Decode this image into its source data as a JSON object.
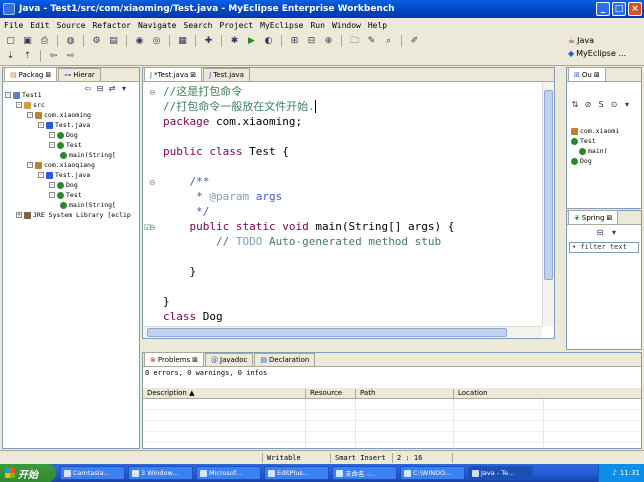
{
  "window": {
    "title": "Java - Test1/src/com/xiaoming/Test.java - MyEclipse Enterprise Workbench"
  },
  "menu": [
    "File",
    "Edit",
    "Source",
    "Refactor",
    "Navigate",
    "Search",
    "Project",
    "MyEclipse",
    "Run",
    "Window",
    "Help"
  ],
  "perspectives": {
    "java": "Java",
    "myeclipse": "MyEclipse ..."
  },
  "left_panel": {
    "tabs": [
      "Packag",
      "Hierar"
    ],
    "tree": [
      {
        "label": "Test1",
        "depth": 0,
        "icon": "project"
      },
      {
        "label": "src",
        "depth": 1,
        "icon": "folder"
      },
      {
        "label": "com.xiaoming",
        "depth": 2,
        "icon": "package"
      },
      {
        "label": "Test.java",
        "depth": 3,
        "icon": "java"
      },
      {
        "label": "Dog",
        "depth": 4,
        "icon": "class"
      },
      {
        "label": "Test",
        "depth": 4,
        "icon": "class"
      },
      {
        "label": "main(String[",
        "depth": 5,
        "icon": "method"
      },
      {
        "label": "com.xiaoqiang",
        "depth": 2,
        "icon": "package"
      },
      {
        "label": "Test.java",
        "depth": 3,
        "icon": "java"
      },
      {
        "label": "Dog",
        "depth": 4,
        "icon": "class"
      },
      {
        "label": "Test",
        "depth": 4,
        "icon": "class"
      },
      {
        "label": "main(String[",
        "depth": 5,
        "icon": "method"
      },
      {
        "label": "JRE System Library [eclip",
        "depth": 1,
        "icon": "library"
      }
    ]
  },
  "editor": {
    "tabs": [
      "*Test.java",
      "Test.java"
    ],
    "lines": [
      [
        {
          "t": "//这是打包命令",
          "c": "cm"
        }
      ],
      [
        {
          "t": "//打包命令一般放在文件开始.",
          "c": "cm"
        }
      ],
      [
        {
          "t": "package",
          "c": "kw"
        },
        {
          "t": " com.xiaoming;",
          "c": ""
        }
      ],
      [],
      [
        {
          "t": "public class",
          "c": "kw"
        },
        {
          "t": " Test {",
          "c": ""
        }
      ],
      [],
      [
        {
          "t": "    /**",
          "c": "jd"
        }
      ],
      [
        {
          "t": "     * ",
          "c": "jd"
        },
        {
          "t": "@param",
          "c": "tg"
        },
        {
          "t": " args",
          "c": "jd"
        }
      ],
      [
        {
          "t": "     */",
          "c": "jd"
        }
      ],
      [
        {
          "t": "    public static void",
          "c": "kw"
        },
        {
          "t": " main(String[] args) {",
          "c": ""
        }
      ],
      [
        {
          "t": "        // ",
          "c": "cm"
        },
        {
          "t": "TODO",
          "c": "tg"
        },
        {
          "t": " Auto-generated method stub",
          "c": "cm"
        }
      ],
      [],
      [
        {
          "t": "    }",
          "c": ""
        }
      ],
      [],
      [
        {
          "t": "}",
          "c": ""
        }
      ],
      [
        {
          "t": "class",
          "c": "kw"
        },
        {
          "t": " Dog",
          "c": ""
        }
      ],
      [
        {
          "t": "{",
          "c": ""
        }
      ]
    ]
  },
  "outline": {
    "tab": "Ou",
    "tree": [
      {
        "label": "com.xiaomi",
        "depth": 0
      },
      {
        "label": "Test",
        "depth": 0
      },
      {
        "label": "main(",
        "depth": 1
      },
      {
        "label": "Dog",
        "depth": 0
      }
    ]
  },
  "spring": {
    "tab": "Spring",
    "filter": "filter text"
  },
  "bottom": {
    "tabs": [
      "Problems",
      "Javadoc",
      "Declaration"
    ],
    "summary": "0 errors, 0 warnings, 0 infos",
    "columns": [
      "Description",
      "Resource",
      "Path",
      "Location"
    ]
  },
  "status": {
    "writable": "Writable",
    "insert": "Smart Insert",
    "position": "2 : 16"
  },
  "taskbar": {
    "start": "开始",
    "tasks": [
      "Camtasia...",
      "3 Window...",
      "Microsof...",
      "EditPlus...",
      "未命名 -...",
      "C:\\WINDO...",
      "Java - Te..."
    ],
    "clock": "11:31"
  }
}
